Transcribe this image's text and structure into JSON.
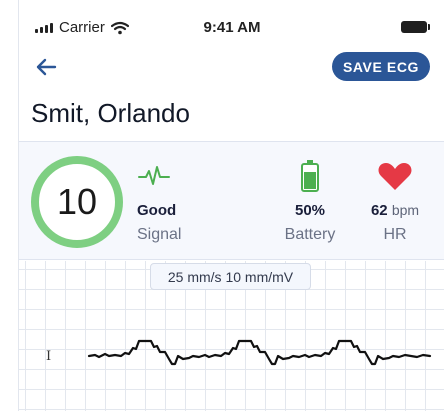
{
  "status_bar": {
    "carrier": "Carrier",
    "time": "9:41 AM"
  },
  "header": {
    "save_label": "SAVE ECG"
  },
  "patient": {
    "name": "Smit, Orlando"
  },
  "score": {
    "value": "10"
  },
  "stats": {
    "signal": {
      "value": "Good",
      "label": "Signal"
    },
    "battery": {
      "value": "50%",
      "label": "Battery"
    },
    "hr": {
      "value": "62",
      "unit": "bpm",
      "label": "HR"
    }
  },
  "ecg": {
    "scale": "25 mm/s 10 mm/mV",
    "lead": "I"
  },
  "colors": {
    "accent": "#2b5697",
    "ring": "#7ecf82",
    "signal_icon": "#4caf50",
    "battery_icon": "#4caf50",
    "heart_icon": "#e53945"
  }
}
